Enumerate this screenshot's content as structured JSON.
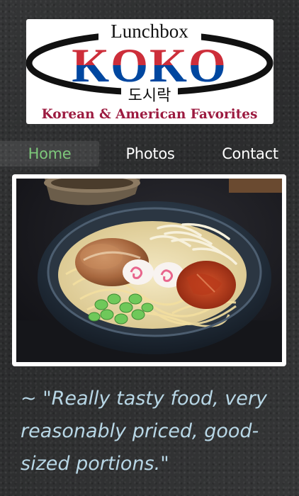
{
  "logo": {
    "top_text": "Lunchbox",
    "brand": "KOKO",
    "hangul": "도시락",
    "tagline": "Korean & American Favorites",
    "colors": {
      "red": "#cd2e3a",
      "blue": "#0047a0",
      "ellipse": "#111111",
      "tagline": "#9c1b40"
    }
  },
  "nav": {
    "items": [
      {
        "label": "Home",
        "active": true
      },
      {
        "label": "Photos",
        "active": false
      },
      {
        "label": "Contact",
        "active": false
      }
    ],
    "active_color": "#7dc77a"
  },
  "hero": {
    "subject": "ramen-bowl-photo"
  },
  "testimonial": {
    "text": "~ \"Really tasty food, very reasonably priced, good-sized portions.\""
  }
}
